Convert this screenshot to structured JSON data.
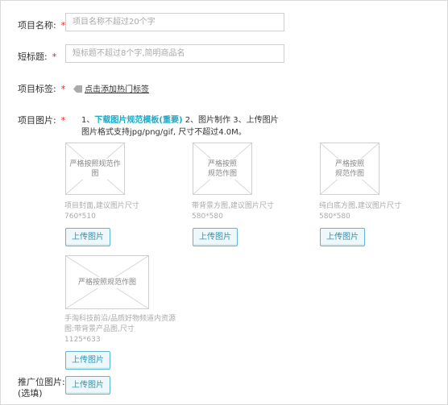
{
  "project_name": {
    "label": "项目名称:",
    "required": "*",
    "placeholder": "项目名称不超过20个字"
  },
  "short_title": {
    "label": "短标题:",
    "required": "*",
    "placeholder": "短标题不超过8个字,简明商品名"
  },
  "project_tags": {
    "label": "项目标签:",
    "required": "*",
    "link": "点击添加热门标签",
    "icon": "tag-icon"
  },
  "project_images": {
    "label": "项目图片:",
    "required": "*",
    "instructions": {
      "prefix": "1、",
      "link": "下载图片规范模板(重要)",
      "rest": " 2、图片制作 3、上传图片",
      "line2": "图片格式支持jpg/png/gif, 尺寸不超过4.0M。"
    },
    "items": [
      {
        "placeholder": "严格按照规范作图",
        "caption": "项目封面,建议图片尺寸",
        "size": "760*510",
        "button": "上传图片"
      },
      {
        "placeholder": "严格按照规范作图",
        "caption": "带背景方图,建议图片尺寸",
        "size": "580*580",
        "button": "上传图片"
      },
      {
        "placeholder": "严格按照规范作图",
        "caption": "纯白底方图,建议图片尺寸",
        "size": "580*580",
        "button": "上传图片"
      },
      {
        "placeholder": "严格按照规范作图",
        "caption": "手淘科技前沿/品质好物频道内资源图:带背景产品图,尺寸",
        "size": "1125*633",
        "button": "上传图片"
      }
    ]
  },
  "promo_image": {
    "label": "推广位图片:",
    "label2": "(选填)",
    "button": "上传图片"
  }
}
